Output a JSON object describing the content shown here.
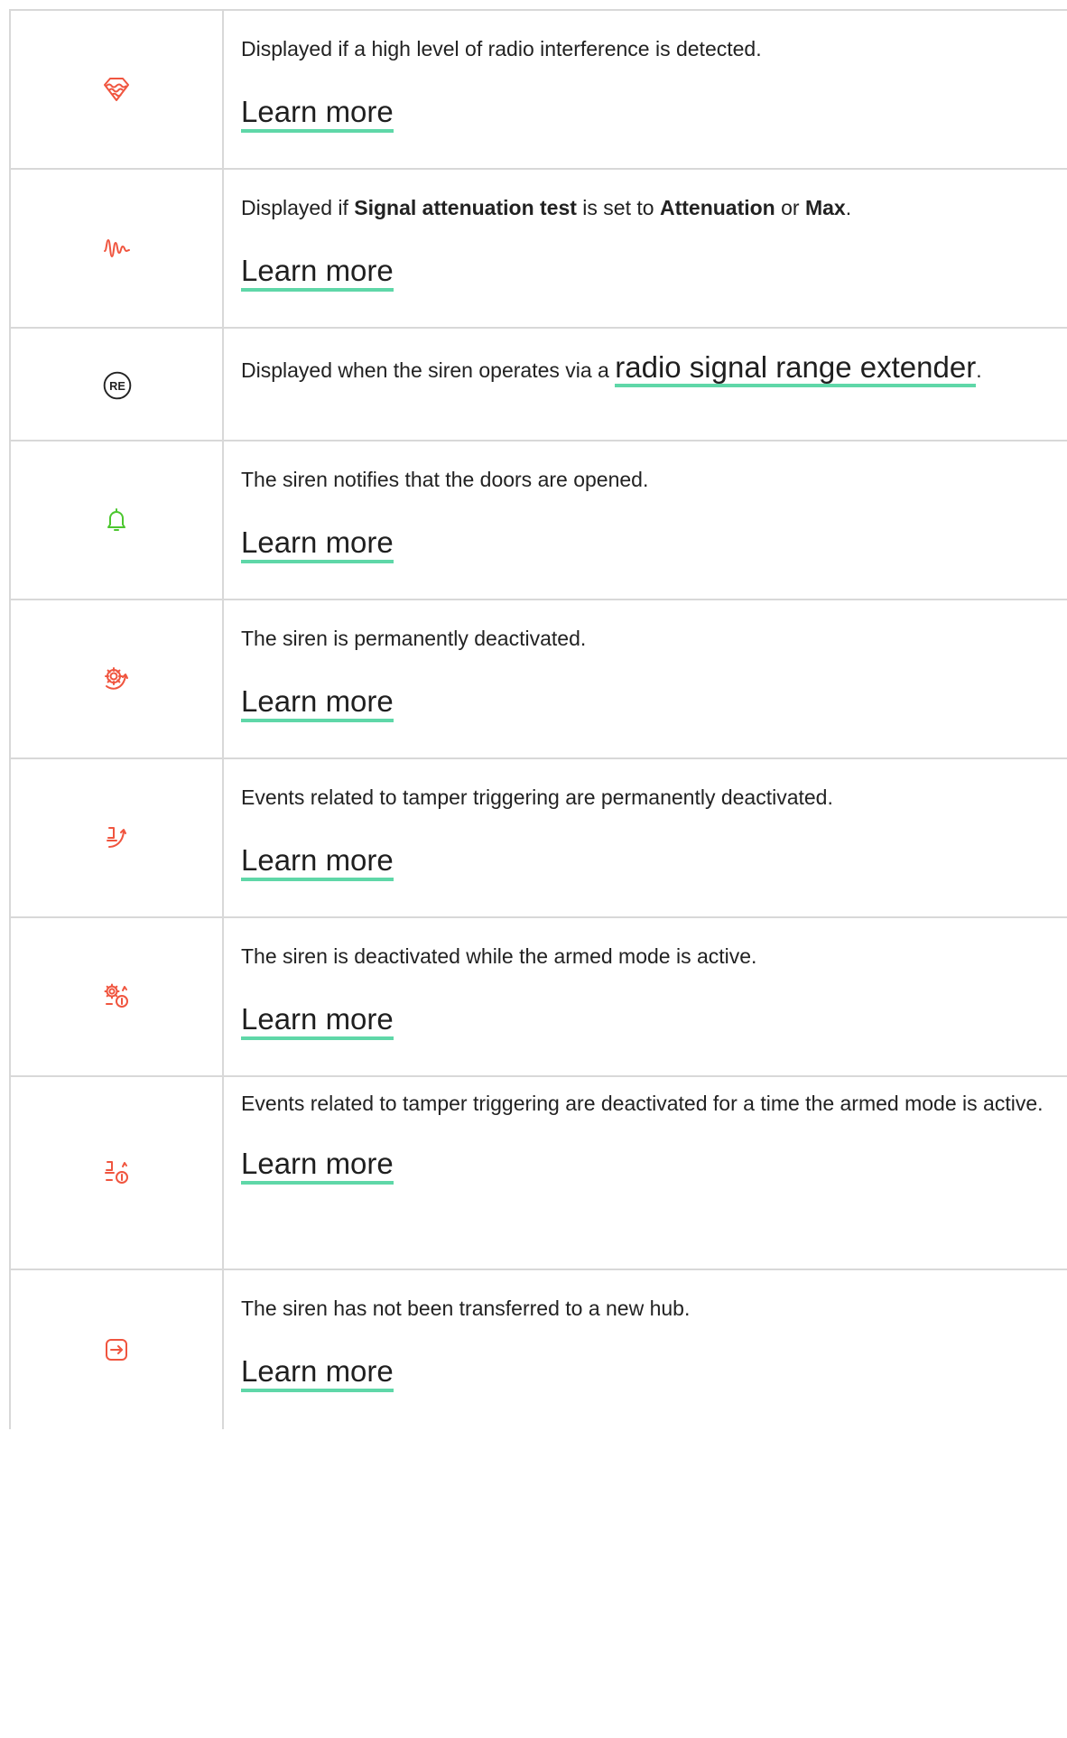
{
  "colors": {
    "icon_red": "#f0553f",
    "icon_green": "#4cc72f",
    "link_underline": "#5fd7a8",
    "border": "#d8d8d8"
  },
  "rows": [
    {
      "icon": "radio-interference-icon",
      "desc": "Displayed if a high level of radio interference is detected.",
      "link": "Learn more"
    },
    {
      "icon": "signal-attenuation-icon",
      "desc_parts": [
        "Displayed if ",
        "Signal attenuation test",
        " is set to ",
        "Attenuation",
        " or ",
        "Max",
        "."
      ],
      "link": "Learn more"
    },
    {
      "icon": "range-extender-icon",
      "icon_text": "RE",
      "desc_prefix": "Displayed when the siren operates via a ",
      "link_text": "radio signal range extender",
      "desc_suffix": "."
    },
    {
      "icon": "bell-icon",
      "desc": "The siren notifies that the doors are opened.",
      "link": "Learn more"
    },
    {
      "icon": "gear-deactivated-icon",
      "desc": "The siren is permanently deactivated.",
      "link": "Learn more"
    },
    {
      "icon": "tamper-deactivated-icon",
      "desc": "Events related to tamper triggering are permanently deactivated.",
      "link": "Learn more"
    },
    {
      "icon": "gear-deactivated-armed-icon",
      "desc": "The siren is deactivated while the armed mode is active.",
      "link": "Learn more"
    },
    {
      "icon": "tamper-deactivated-armed-icon",
      "desc": "Events related to tamper triggering are deactivated for a time the armed mode is active.",
      "link": "Learn more"
    },
    {
      "icon": "transfer-icon",
      "desc": "The siren has not been transferred to a new hub.",
      "link": "Learn more"
    }
  ]
}
